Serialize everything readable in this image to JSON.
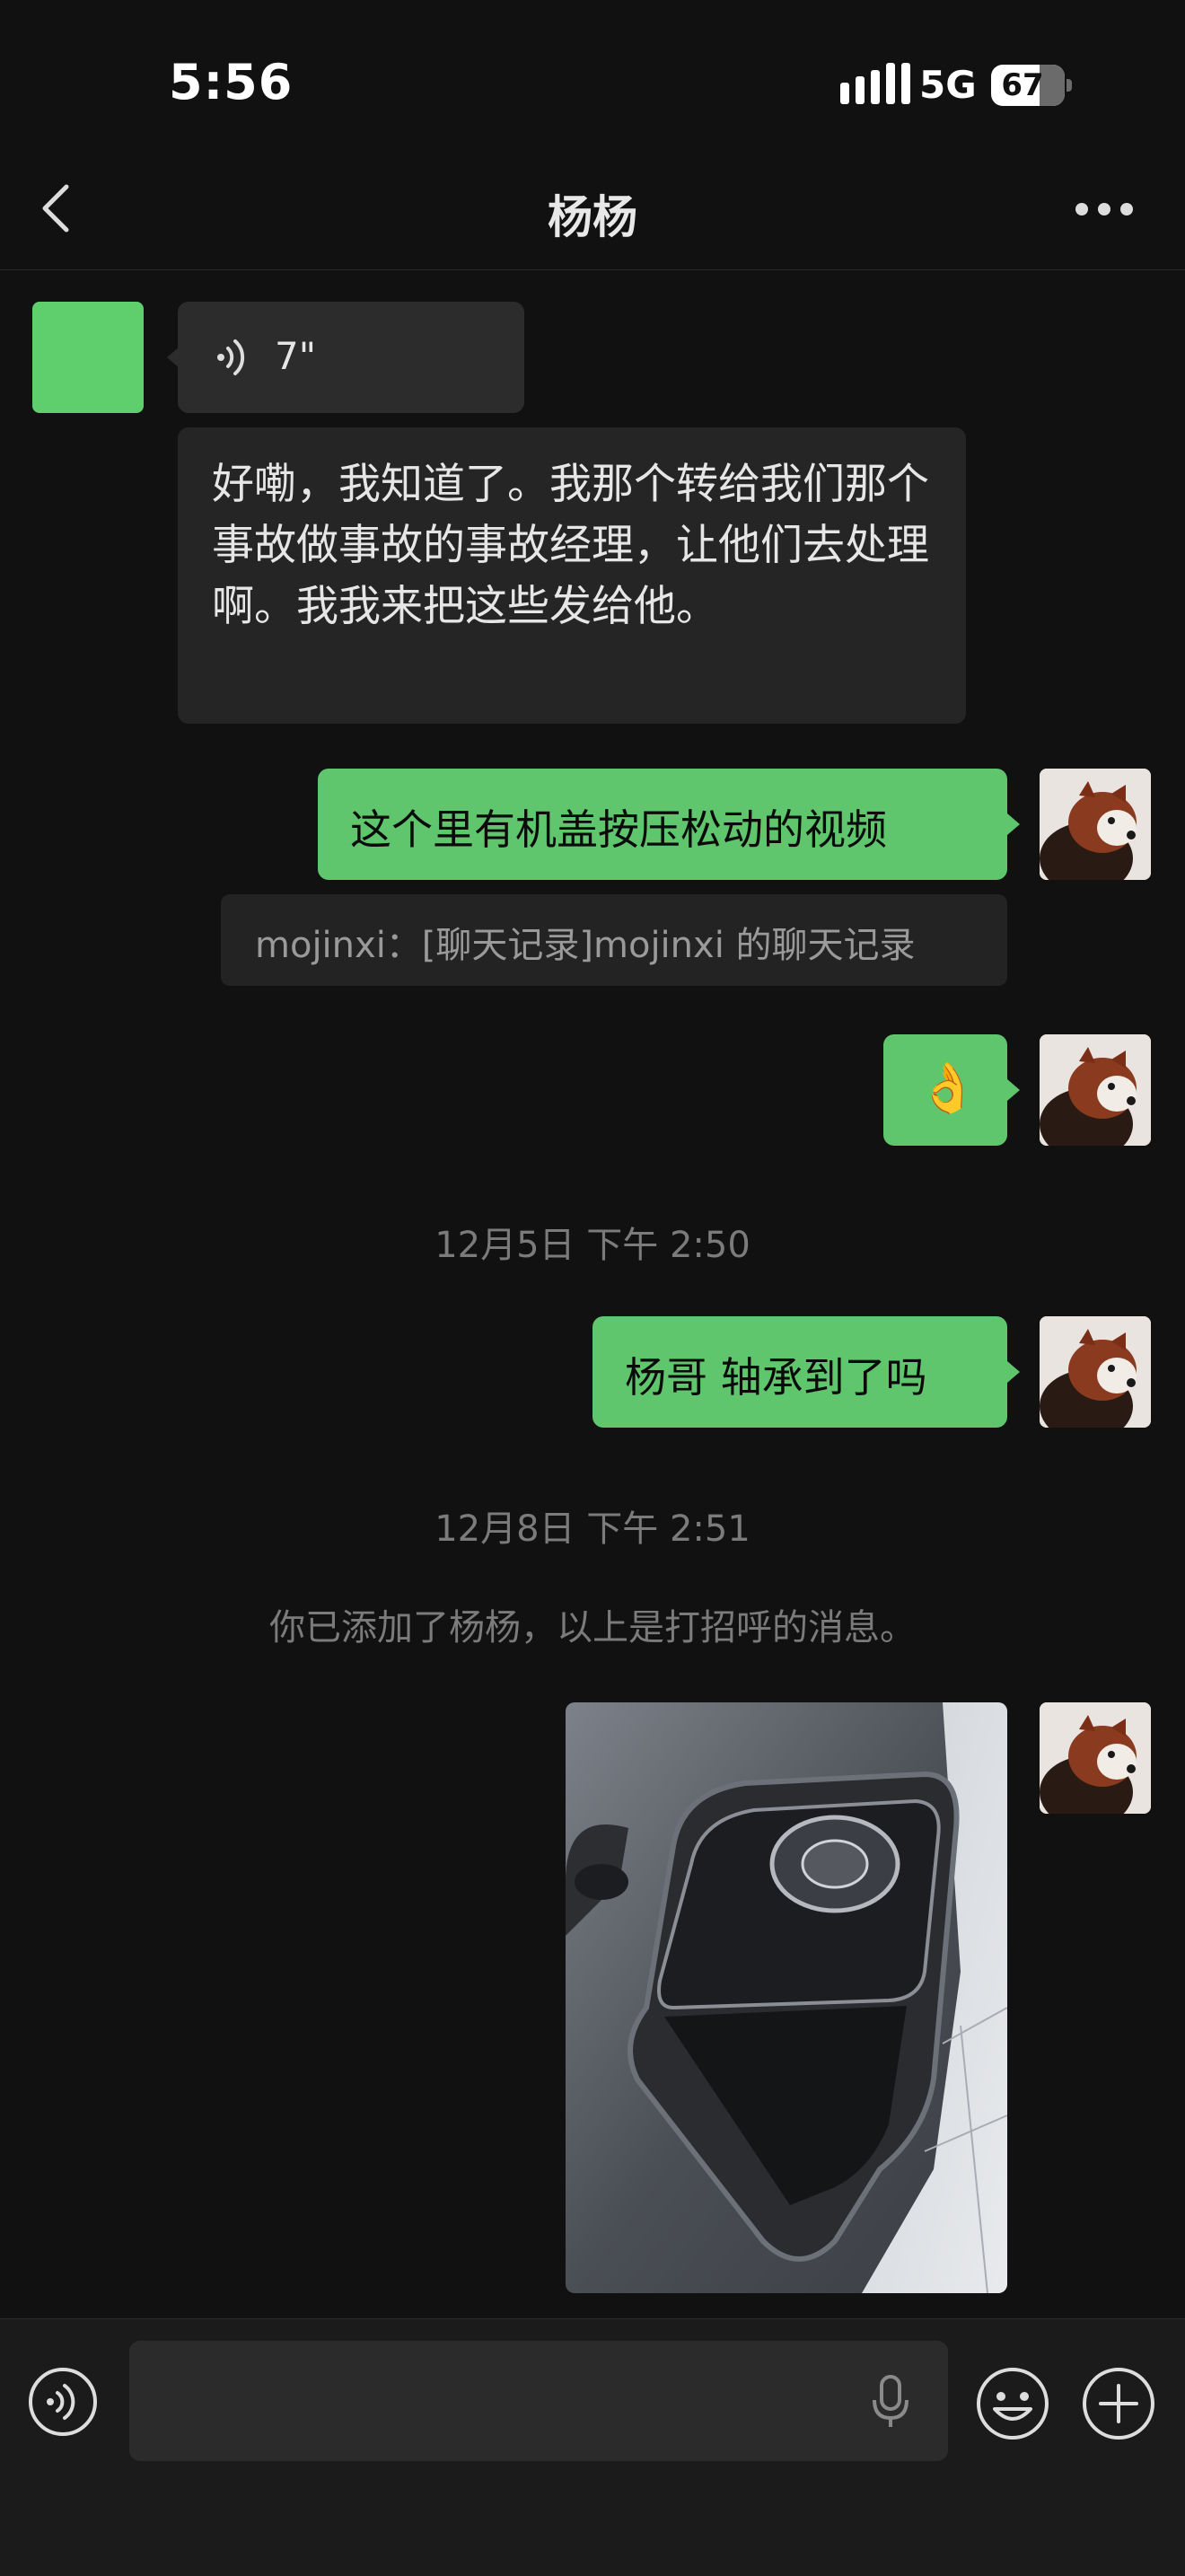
{
  "status_bar": {
    "time": "5:56",
    "network": "5G",
    "battery": "67"
  },
  "nav": {
    "title": "杨杨"
  },
  "chat": {
    "voice_message": {
      "duration": "7\""
    },
    "voice_transcript": "好嘞，我知道了。我那个转给我们那个事故做事故的事故经理，让他们去处理啊。我我来把这些发给他。",
    "sent_message_1": "这个里有机盖按压松动的视频",
    "quoted_reply": "mojinxi：[聊天记录]mojinxi 的聊天记录",
    "sent_emoji": "👌",
    "timestamp_1": "12月5日 下午 2:50",
    "sent_message_2": "杨哥 轴承到了吗",
    "timestamp_2": "12月8日 下午 2:51",
    "system_notice": "你已添加了杨杨，以上是打招呼的消息。"
  },
  "colors": {
    "background": "#111111",
    "sent_bubble": "#5fc66d",
    "received_bubble": "#2c2c2c",
    "timestamp_text": "#7b7b7b"
  },
  "icons": {
    "back": "chevron-left-icon",
    "more": "more-dots-icon",
    "voice_toggle": "voice-input-icon",
    "mic": "microphone-icon",
    "emoji": "emoji-icon",
    "plus": "plus-icon"
  }
}
